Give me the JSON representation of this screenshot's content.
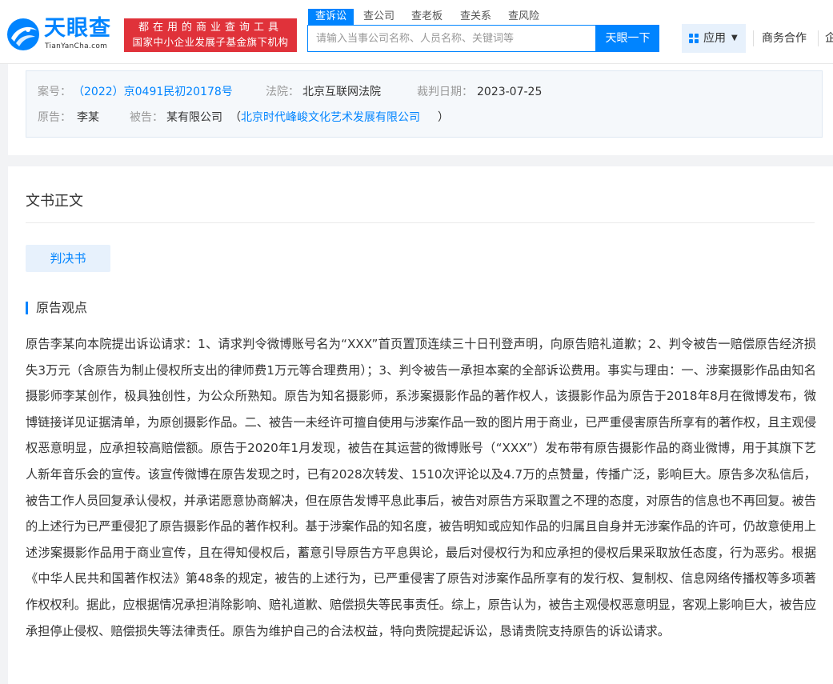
{
  "header": {
    "logo_text": "天眼查",
    "logo_domain": "TianYanCha.com",
    "slogan_line1": "都在用的商业查询工具",
    "slogan_line2": "国家中小企业发展子基金旗下机构",
    "tabs": [
      {
        "label": "查诉讼",
        "active": true
      },
      {
        "label": "查公司",
        "active": false
      },
      {
        "label": "查老板",
        "active": false
      },
      {
        "label": "查关系",
        "active": false
      },
      {
        "label": "查风险",
        "active": false
      }
    ],
    "search_placeholder": "请输入当事公司名称、人员名称、关键词等",
    "search_button": "天眼一下",
    "app_button": "应用",
    "business_link": "商务合作",
    "enterprise_link": "企"
  },
  "case_info": {
    "case_no_label": "案号：",
    "case_no": "（2022）京0491民初20178号",
    "court_label": "法院：",
    "court": "北京互联网法院",
    "date_label": "裁判日期：",
    "date": "2023-07-25",
    "plaintiff_label": "原告：",
    "plaintiff": "李某",
    "defendant_label": "被告：",
    "defendant": "某有限公司",
    "defendant_paren_open": "（",
    "defendant_real_name": "北京时代峰峻文化艺术发展有限公司",
    "defendant_paren_close": "）"
  },
  "document": {
    "section_title": "文书正文",
    "doc_tab": "判决书",
    "sub_title": "原告观点",
    "body": "原告李某向本院提出诉讼请求：1、请求判令微博账号名为“XXX”首页置顶连续三十日刊登声明，向原告赔礼道歉；2、判令被告一赔偿原告经济损失3万元（含原告为制止侵权所支出的律师费1万元等合理费用）；3、判令被告一承担本案的全部诉讼费用。事实与理由：一、涉案摄影作品由知名摄影师李某创作，极具独创性，为公众所熟知。原告为知名摄影师，系涉案摄影作品的著作权人，该摄影作品为原告于2018年8月在微博发布，微博链接详见证据清单，为原创摄影作品。二、被告一未经许可擅自使用与涉案作品一致的图片用于商业，已严重侵害原告所享有的著作权，且主观侵权恶意明显，应承担较高赔偿额。原告于2020年1月发现，被告在其运营的微博账号（“XXX”）发布带有原告摄影作品的商业微博，用于其旗下艺人新年音乐会的宣传。该宣传微博在原告发现之时，已有2028次转发、1510次评论以及4.7万的点赞量，传播广泛，影响巨大。原告多次私信后，被告工作人员回复承认侵权，并承诺愿意协商解决，但在原告发博平息此事后，被告对原告方采取置之不理的态度，对原告的信息也不再回复。被告的上述行为已严重侵犯了原告摄影作品的著作权利。基于涉案作品的知名度，被告明知或应知作品的归属且自身并无涉案作品的许可，仍故意使用上述涉案摄影作品用于商业宣传，且在得知侵权后，蓄意引导原告方平息舆论，最后对侵权行为和应承担的侵权后果采取放任态度，行为恶劣。根据《中华人民共和国著作权法》第48条的规定，被告的上述行为，已严重侵害了原告对涉案作品所享有的发行权、复制权、信息网络传播权等多项著作权权利。据此，应根据情况承担消除影响、赔礼道歉、赔偿损失等民事责任。综上，原告认为，被告主观侵权恶意明显，客观上影响巨大，被告应承担停止侵权、赔偿损失等法律责任。原告为维护自己的合法权益，特向贵院提起诉讼，恳请贵院支持原告的诉讼请求。"
  },
  "colors": {
    "brand_blue": "#0084ff",
    "slogan_red": "#e0323a",
    "page_bg": "#f2f3f5"
  }
}
